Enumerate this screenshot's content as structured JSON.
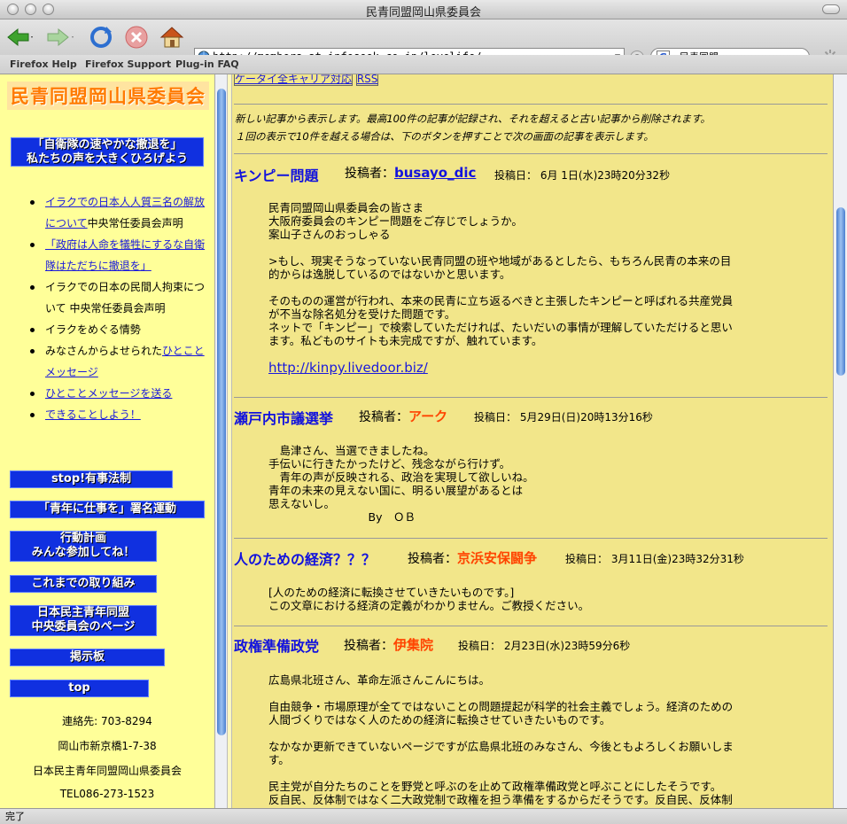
{
  "window": {
    "title": "民青同盟岡山県委員会"
  },
  "toolbar": {
    "url": "http://members.at.infoseek.co.jp/lovelife/",
    "search_value": "民青同盟",
    "search_engine_letter": "G"
  },
  "bookmarks": [
    "Firefox Help",
    "Firefox Support",
    "Plug-in FAQ"
  ],
  "status": "完了",
  "sidebar": {
    "logo": "民青同盟岡山県委員会",
    "banner_top": [
      "「自衛隊の速やかな撤退を」",
      "私たちの声を大きくひろげよう"
    ],
    "nav": [
      {
        "link": "イラクでの日本人人質三名の解放について",
        "rest": "中央常任委員会声明"
      },
      {
        "link": "「政府は人命を犠牲にするな自衛隊はただちに撤退を」",
        "rest": ""
      },
      {
        "link": "",
        "rest": "イラクでの日本の民間人拘束について 中央常任委員会声明"
      },
      {
        "link": "",
        "rest": "イラクをめぐる情勢"
      },
      {
        "pre": "みなさんからよせられた",
        "link": "ひとことメッセージ",
        "rest": ""
      },
      {
        "link": "ひとことメッセージを送る",
        "rest": ""
      },
      {
        "link": "できることしよう！",
        "rest": ""
      }
    ],
    "buttons": {
      "b1": "stop!有事法制",
      "b2": "「青年に仕事を」署名運動",
      "b3a": "行動計画",
      "b3b": "みんな参加してね！",
      "b4": "これまでの取り組み",
      "b5a": "日本民主青年同盟",
      "b5b": "中央委員会のページ",
      "b6": "掲示板",
      "b7": "top"
    },
    "contact": [
      "連絡先: 703-8294",
      "岡山市新京橋1-7-38",
      "日本民主青年同盟岡山県委員会",
      "TEL086-273-1523"
    ]
  },
  "main": {
    "top_links": [
      "ケータイ全キャリア対応",
      "RSS"
    ],
    "intro": [
      "新しい記事から表示します。最高100件の記事が記録され、それを超えると古い記事から削除されます。",
      "１回の表示で10件を越える場合は、下のボタンを押すことで次の画面の記事を表示します。"
    ],
    "poster_label": "投稿者：",
    "posts": [
      {
        "title": "キンピー問題",
        "poster": "busayo_dic",
        "date": "投稿日： 6月 1日(水)23時20分32秒",
        "body": "民青同盟岡山県委員会の皆さま\n大阪府委員会のキンピー問題をご存じでしょうか。\n案山子さんのおっしゃる\n\n>もし、現実そうなっていない民青同盟の班や地域があるとしたら、もちろん民青の本来の目\n的からは逸脱しているのではないかと思います。\n\nそのものの運営が行われ、本来の民青に立ち返るべきと主張したキンピーと呼ばれる共産党員\nが不当な除名処分を受けた問題です。\nネットで「キンピー」で検索していただければ、たいだいの事情が理解していただけると思い\nます。私どものサイトも未完成ですが、触れています。",
        "link": "http://kinpy.livedoor.biz/"
      },
      {
        "title": "瀬戸内市議選挙",
        "poster": "アーク",
        "date": "投稿日： 5月29日(日)20時13分16秒",
        "body": "　島津さん、当選できましたね。\n手伝いに行きたかったけど、残念ながら行けず。\n　青年の声が反映される、政治を実現して欲しいね。\n青年の未来の見えない国に、明るい展望があるとは\n思えないし。\n　　　　　　　　　By　ＯＢ"
      },
      {
        "title": "人のための経済？？？",
        "poster": "京浜安保闘争",
        "date": "投稿日： 3月11日(金)23時32分31秒",
        "body": "[人のための経済に転換させていきたいものです。]\nこの文章における経済の定義がわかりません。ご教授ください。"
      },
      {
        "title": "政権準備政党",
        "poster": "伊集院",
        "date": "投稿日： 2月23日(水)23時59分6秒",
        "body": "広島県北班さん、革命左派さんこんにちは。\n\n自由競争・市場原理が全てではないことの問題提起が科学的社会主義でしょう。経済のための\n人間づくりではなく人のための経済に転換させていきたいものです。\n\nなかなか更新できていないページですが広島県北班のみなさん、今後ともよろしくお願いしま\nす。\n\n民主党が自分たちのことを野党と呼ぶのを止めて政権準備政党と呼ぶことにしたそうです。\n反自民、反体制ではなく二大政党制で政権を担う準備をするからだそうです。反自民、反体制"
      }
    ]
  },
  "colors": {
    "sidebar_bg": "#ffff99",
    "main_bg": "#f2e68a",
    "banner_blue": "#1030e0",
    "title_blue": "#1212dd",
    "poster_red": "#ff4400"
  }
}
